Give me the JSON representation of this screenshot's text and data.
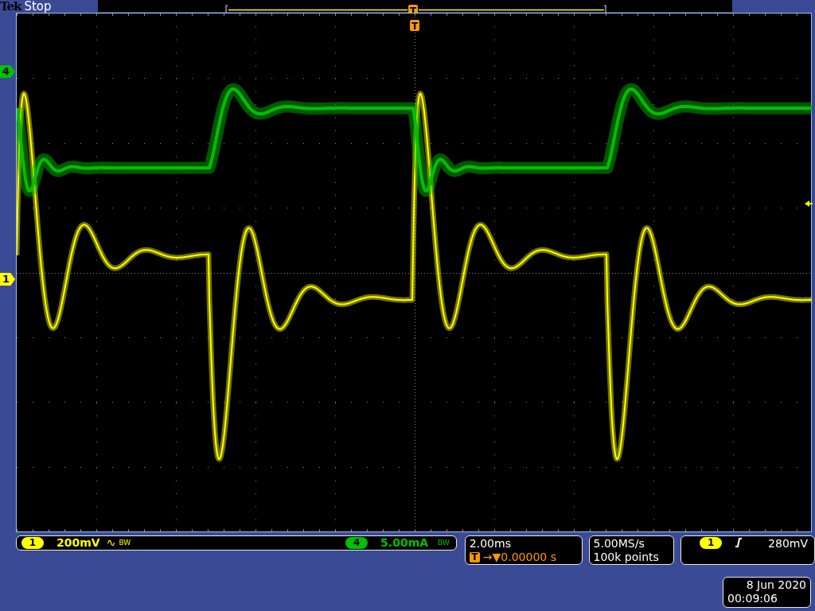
{
  "header": {
    "brand": "Tek",
    "acq_state": "Stop",
    "trigger_marker": "T"
  },
  "graticule": {
    "trigger_marker": "T",
    "markers": [
      {
        "number": "4",
        "color": "#00c000"
      },
      {
        "number": "1",
        "color": "#ffff00"
      }
    ]
  },
  "channels": [
    {
      "number": "1",
      "color": "#ffff00",
      "scale": "200mV",
      "coupling": "∿",
      "bw_label": "BW"
    },
    {
      "number": "4",
      "color": "#00c000",
      "scale": "5.00mA",
      "bw_label": "BW"
    }
  ],
  "horizontal": {
    "scale": "2.00ms",
    "trigger_marker": "T",
    "delay": "→▼0.00000 s"
  },
  "acquisition": {
    "sample_rate": "5.00MS/s",
    "record_length": "100k points"
  },
  "trigger": {
    "source": "1",
    "level": "280mV"
  },
  "datetime": {
    "date": "8 Jun 2020",
    "time": "00:09:06"
  }
}
